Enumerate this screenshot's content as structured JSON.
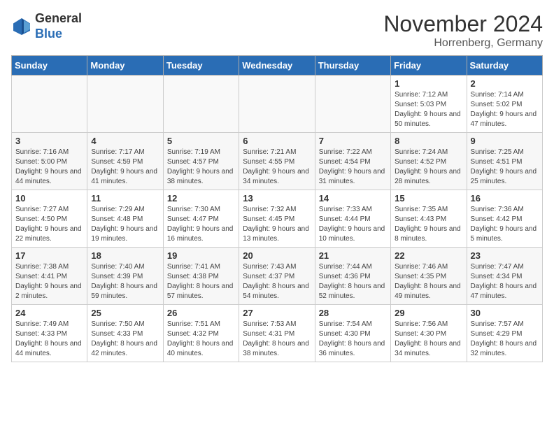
{
  "header": {
    "logo": {
      "line1": "General",
      "line2": "Blue"
    },
    "title": "November 2024",
    "location": "Horrenberg, Germany"
  },
  "weekdays": [
    "Sunday",
    "Monday",
    "Tuesday",
    "Wednesday",
    "Thursday",
    "Friday",
    "Saturday"
  ],
  "weeks": [
    [
      null,
      null,
      null,
      null,
      null,
      {
        "day": "1",
        "sunrise": "Sunrise: 7:12 AM",
        "sunset": "Sunset: 5:03 PM",
        "daylight": "Daylight: 9 hours and 50 minutes."
      },
      {
        "day": "2",
        "sunrise": "Sunrise: 7:14 AM",
        "sunset": "Sunset: 5:02 PM",
        "daylight": "Daylight: 9 hours and 47 minutes."
      }
    ],
    [
      {
        "day": "3",
        "sunrise": "Sunrise: 7:16 AM",
        "sunset": "Sunset: 5:00 PM",
        "daylight": "Daylight: 9 hours and 44 minutes."
      },
      {
        "day": "4",
        "sunrise": "Sunrise: 7:17 AM",
        "sunset": "Sunset: 4:59 PM",
        "daylight": "Daylight: 9 hours and 41 minutes."
      },
      {
        "day": "5",
        "sunrise": "Sunrise: 7:19 AM",
        "sunset": "Sunset: 4:57 PM",
        "daylight": "Daylight: 9 hours and 38 minutes."
      },
      {
        "day": "6",
        "sunrise": "Sunrise: 7:21 AM",
        "sunset": "Sunset: 4:55 PM",
        "daylight": "Daylight: 9 hours and 34 minutes."
      },
      {
        "day": "7",
        "sunrise": "Sunrise: 7:22 AM",
        "sunset": "Sunset: 4:54 PM",
        "daylight": "Daylight: 9 hours and 31 minutes."
      },
      {
        "day": "8",
        "sunrise": "Sunrise: 7:24 AM",
        "sunset": "Sunset: 4:52 PM",
        "daylight": "Daylight: 9 hours and 28 minutes."
      },
      {
        "day": "9",
        "sunrise": "Sunrise: 7:25 AM",
        "sunset": "Sunset: 4:51 PM",
        "daylight": "Daylight: 9 hours and 25 minutes."
      }
    ],
    [
      {
        "day": "10",
        "sunrise": "Sunrise: 7:27 AM",
        "sunset": "Sunset: 4:50 PM",
        "daylight": "Daylight: 9 hours and 22 minutes."
      },
      {
        "day": "11",
        "sunrise": "Sunrise: 7:29 AM",
        "sunset": "Sunset: 4:48 PM",
        "daylight": "Daylight: 9 hours and 19 minutes."
      },
      {
        "day": "12",
        "sunrise": "Sunrise: 7:30 AM",
        "sunset": "Sunset: 4:47 PM",
        "daylight": "Daylight: 9 hours and 16 minutes."
      },
      {
        "day": "13",
        "sunrise": "Sunrise: 7:32 AM",
        "sunset": "Sunset: 4:45 PM",
        "daylight": "Daylight: 9 hours and 13 minutes."
      },
      {
        "day": "14",
        "sunrise": "Sunrise: 7:33 AM",
        "sunset": "Sunset: 4:44 PM",
        "daylight": "Daylight: 9 hours and 10 minutes."
      },
      {
        "day": "15",
        "sunrise": "Sunrise: 7:35 AM",
        "sunset": "Sunset: 4:43 PM",
        "daylight": "Daylight: 9 hours and 8 minutes."
      },
      {
        "day": "16",
        "sunrise": "Sunrise: 7:36 AM",
        "sunset": "Sunset: 4:42 PM",
        "daylight": "Daylight: 9 hours and 5 minutes."
      }
    ],
    [
      {
        "day": "17",
        "sunrise": "Sunrise: 7:38 AM",
        "sunset": "Sunset: 4:41 PM",
        "daylight": "Daylight: 9 hours and 2 minutes."
      },
      {
        "day": "18",
        "sunrise": "Sunrise: 7:40 AM",
        "sunset": "Sunset: 4:39 PM",
        "daylight": "Daylight: 8 hours and 59 minutes."
      },
      {
        "day": "19",
        "sunrise": "Sunrise: 7:41 AM",
        "sunset": "Sunset: 4:38 PM",
        "daylight": "Daylight: 8 hours and 57 minutes."
      },
      {
        "day": "20",
        "sunrise": "Sunrise: 7:43 AM",
        "sunset": "Sunset: 4:37 PM",
        "daylight": "Daylight: 8 hours and 54 minutes."
      },
      {
        "day": "21",
        "sunrise": "Sunrise: 7:44 AM",
        "sunset": "Sunset: 4:36 PM",
        "daylight": "Daylight: 8 hours and 52 minutes."
      },
      {
        "day": "22",
        "sunrise": "Sunrise: 7:46 AM",
        "sunset": "Sunset: 4:35 PM",
        "daylight": "Daylight: 8 hours and 49 minutes."
      },
      {
        "day": "23",
        "sunrise": "Sunrise: 7:47 AM",
        "sunset": "Sunset: 4:34 PM",
        "daylight": "Daylight: 8 hours and 47 minutes."
      }
    ],
    [
      {
        "day": "24",
        "sunrise": "Sunrise: 7:49 AM",
        "sunset": "Sunset: 4:33 PM",
        "daylight": "Daylight: 8 hours and 44 minutes."
      },
      {
        "day": "25",
        "sunrise": "Sunrise: 7:50 AM",
        "sunset": "Sunset: 4:33 PM",
        "daylight": "Daylight: 8 hours and 42 minutes."
      },
      {
        "day": "26",
        "sunrise": "Sunrise: 7:51 AM",
        "sunset": "Sunset: 4:32 PM",
        "daylight": "Daylight: 8 hours and 40 minutes."
      },
      {
        "day": "27",
        "sunrise": "Sunrise: 7:53 AM",
        "sunset": "Sunset: 4:31 PM",
        "daylight": "Daylight: 8 hours and 38 minutes."
      },
      {
        "day": "28",
        "sunrise": "Sunrise: 7:54 AM",
        "sunset": "Sunset: 4:30 PM",
        "daylight": "Daylight: 8 hours and 36 minutes."
      },
      {
        "day": "29",
        "sunrise": "Sunrise: 7:56 AM",
        "sunset": "Sunset: 4:30 PM",
        "daylight": "Daylight: 8 hours and 34 minutes."
      },
      {
        "day": "30",
        "sunrise": "Sunrise: 7:57 AM",
        "sunset": "Sunset: 4:29 PM",
        "daylight": "Daylight: 8 hours and 32 minutes."
      }
    ]
  ]
}
